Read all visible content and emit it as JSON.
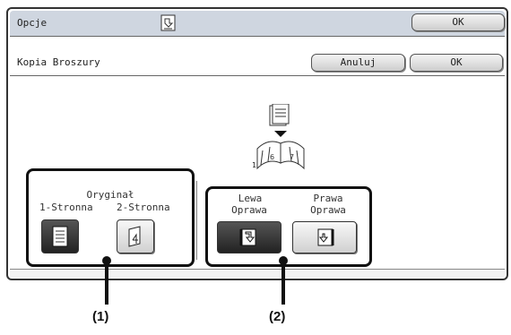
{
  "header": {
    "title": "Opcje",
    "ok_label": "OK"
  },
  "subheader": {
    "title": "Kopia Broszury",
    "cancel_label": "Anuluj",
    "ok_label": "OK"
  },
  "illustration": {
    "page_marker": "1"
  },
  "original": {
    "heading": "Oryginał",
    "one_sided_label": "1-Stronna",
    "two_sided_label": "2-Stronna",
    "selected": "1-Stronna"
  },
  "binding": {
    "left_label_line1": "Lewa",
    "left_label_line2": "Oprawa",
    "right_label_line1": "Prawa",
    "right_label_line2": "Oprawa",
    "selected": "Lewa Oprawa"
  },
  "callouts": {
    "first": "(1)",
    "second": "(2)"
  },
  "colors": {
    "header_bg": "#cfd6e0",
    "selected_tile": "#333333",
    "border": "#111111"
  }
}
